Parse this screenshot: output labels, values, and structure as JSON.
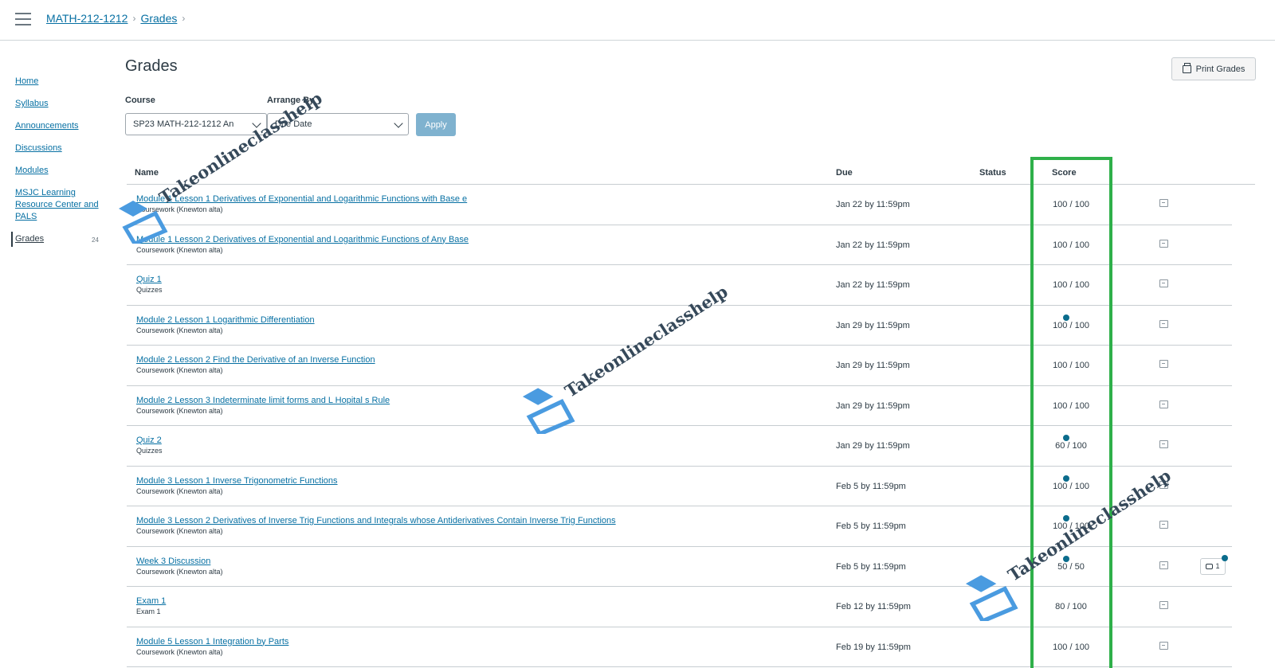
{
  "breadcrumb": {
    "course": "MATH-212-1212",
    "current": "Grades"
  },
  "nav": {
    "items": [
      {
        "label": "Home"
      },
      {
        "label": "Syllabus"
      },
      {
        "label": "Announcements"
      },
      {
        "label": "Discussions"
      },
      {
        "label": "Modules"
      },
      {
        "label": "MSJC Learning Resource Center and PALS"
      },
      {
        "label": "Grades",
        "badge": "24"
      }
    ]
  },
  "page": {
    "title": "Grades",
    "print_label": "Print Grades"
  },
  "filters": {
    "course_label": "Course",
    "course_value": "SP23 MATH-212-1212 An",
    "arrange_label": "Arrange By",
    "arrange_value": "Due Date",
    "apply_label": "Apply"
  },
  "table": {
    "headers": {
      "name": "Name",
      "due": "Due",
      "status": "Status",
      "score": "Score"
    },
    "rows": [
      {
        "name": "Module 1 Lesson 1 Derivatives of Exponential and Logarithmic Functions with Base e",
        "type": "Coursework (Knewton alta)",
        "due": "Jan 22 by 11:59pm",
        "score": "100 / 100",
        "dot": false
      },
      {
        "name": "Module 1 Lesson 2 Derivatives of Exponential and Logarithmic Functions of Any Base",
        "type": "Coursework (Knewton alta)",
        "due": "Jan 22 by 11:59pm",
        "score": "100 / 100",
        "dot": false
      },
      {
        "name": "Quiz 1",
        "type": "Quizzes",
        "due": "Jan 22 by 11:59pm",
        "score": "100 / 100",
        "dot": false
      },
      {
        "name": "Module 2 Lesson 1 Logarithmic Differentiation",
        "type": "Coursework (Knewton alta)",
        "due": "Jan 29 by 11:59pm",
        "score": "100 / 100",
        "dot": true
      },
      {
        "name": "Module 2 Lesson 2 Find the Derivative of an Inverse Function",
        "type": "Coursework (Knewton alta)",
        "due": "Jan 29 by 11:59pm",
        "score": "100 / 100",
        "dot": false
      },
      {
        "name": "Module 2 Lesson 3 Indeterminate limit forms and L Hopital s Rule",
        "type": "Coursework (Knewton alta)",
        "due": "Jan 29 by 11:59pm",
        "score": "100 / 100",
        "dot": false
      },
      {
        "name": "Quiz 2",
        "type": "Quizzes",
        "due": "Jan 29 by 11:59pm",
        "score": "60 / 100",
        "dot": true
      },
      {
        "name": "Module 3 Lesson 1 Inverse Trigonometric Functions",
        "type": "Coursework (Knewton alta)",
        "due": "Feb 5 by 11:59pm",
        "score": "100 / 100",
        "dot": true
      },
      {
        "name": "Module 3 Lesson 2 Derivatives of Inverse Trig Functions and Integrals whose Antiderivatives Contain Inverse Trig Functions",
        "type": "Coursework (Knewton alta)",
        "due": "Feb 5 by 11:59pm",
        "score": "100 / 100",
        "dot": true
      },
      {
        "name": "Week 3 Discussion",
        "type": "Coursework (Knewton alta)",
        "due": "Feb 5 by 11:59pm",
        "score": "50 / 50",
        "dot": true,
        "comments": "1"
      },
      {
        "name": "Exam 1",
        "type": "Exam 1",
        "due": "Feb 12 by 11:59pm",
        "score": "80 / 100",
        "dot": false
      },
      {
        "name": "Module 5 Lesson 1 Integration by Parts",
        "type": "Coursework (Knewton alta)",
        "due": "Feb 19 by 11:59pm",
        "score": "100 / 100",
        "dot": false
      }
    ]
  },
  "watermark": {
    "text": "Takeonlineclasshelp"
  },
  "colors": {
    "link": "#0770a3",
    "highlight": "#2fb04a",
    "unread_dot": "#0b6c8c",
    "apply_button": "#7fb2cf"
  }
}
